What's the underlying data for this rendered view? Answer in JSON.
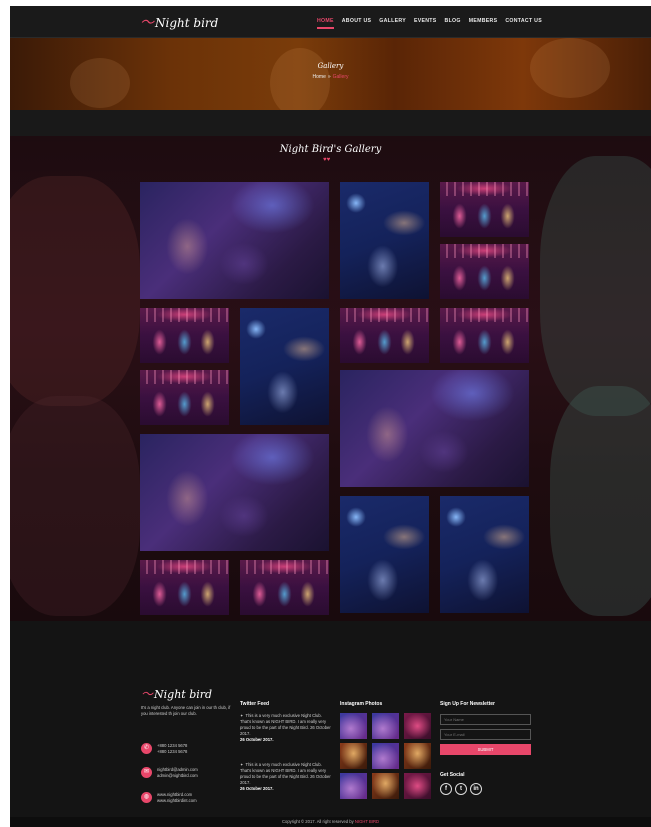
{
  "nav": {
    "logo": "Night bird",
    "items": [
      {
        "label": "HOME",
        "active": true
      },
      {
        "label": "ABOUT US",
        "active": false
      },
      {
        "label": "GALLERY",
        "active": false
      },
      {
        "label": "EVENTS",
        "active": false
      },
      {
        "label": "BLOG",
        "active": false
      },
      {
        "label": "MEMBERS",
        "active": false
      },
      {
        "label": "CONTACT US",
        "active": false
      }
    ]
  },
  "hero": {
    "title": "Gallery",
    "breadcrumb": {
      "home": "Home",
      "separator": "»",
      "current": "Gallery"
    }
  },
  "gallery": {
    "title": "Night Bird's Gallery",
    "divider_icon": "heart-icon",
    "accent": "#e8476a",
    "tiles": [
      {
        "photo": "crowd"
      },
      {
        "photo": "singer"
      },
      {
        "photo": "girls"
      },
      {
        "photo": "girls"
      },
      {
        "photo": "girls"
      },
      {
        "photo": "singer"
      },
      {
        "photo": "girls"
      },
      {
        "photo": "girls"
      },
      {
        "photo": "girls"
      },
      {
        "photo": "crowd"
      },
      {
        "photo": "crowd"
      },
      {
        "photo": "singer"
      },
      {
        "photo": "singer"
      },
      {
        "photo": "girls"
      },
      {
        "photo": "girls"
      }
    ]
  },
  "footer": {
    "logo": "Night bird",
    "about": "It's a night club. Anyone can join in our th club, if you interested th join our club.",
    "contacts": {
      "phones": "+880 1234 5678\n+880 1234 5678",
      "emails": "nightbird@admin.com\nadmin@nightbird.com",
      "sites": "www.nightbird.com\nwww.nightbirdint.com"
    },
    "twitter": {
      "heading": "Twitter Feed",
      "tweets": [
        {
          "text": "This is a very much exclusive Night Club. That's known as NIGHT BIRD. I am really very proud to be the part of the Night Bird. 26 October 2017.",
          "date": "26 October 2017."
        },
        {
          "text": "This is a very much exclusive Night Club. That's known as NIGHT BIRD. I am really very proud to be the part of the Night Bird. 26 October 2017.",
          "date": "26 October 2017."
        }
      ]
    },
    "instagram": {
      "heading": "Instagram Photos"
    },
    "newsletter": {
      "heading": "Sign Up For Newsletter",
      "name_placeholder": "Your Name",
      "email_placeholder": "Your E-mail",
      "submit_label": "SUBMIT"
    },
    "social": {
      "heading": "Get Social",
      "icons": [
        "facebook-icon",
        "twitter-icon",
        "linkedin-icon"
      ]
    },
    "copyright": {
      "text": "Copyright © 2017. All right reserved by",
      "brand": "NIGHT BIRD"
    }
  }
}
